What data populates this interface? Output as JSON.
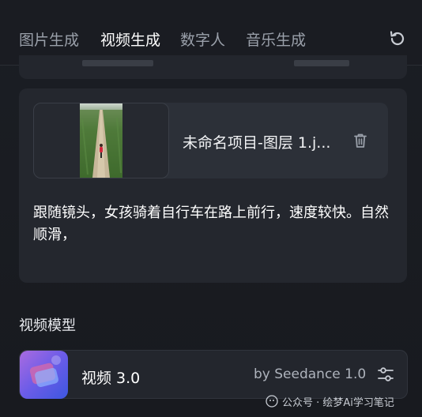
{
  "tabs": [
    {
      "label": "图片生成"
    },
    {
      "label": "视频生成",
      "active": true
    },
    {
      "label": "数字人"
    },
    {
      "label": "音乐生成"
    }
  ],
  "header": {
    "refresh_icon": "refresh-icon"
  },
  "upload": {
    "file_name": "未命名项目-图层 1.j...",
    "delete_icon": "trash-icon"
  },
  "prompt": {
    "text": "跟随镜头，女孩骑着自行车在路上前行，速度较快。自然顺滑，"
  },
  "model_section": {
    "title": "视频模型",
    "model_name": "视频 3.0",
    "provider": "by Seedance 1.0",
    "settings_icon": "sliders-icon"
  },
  "watermark": {
    "text": "公众号 · 绘梦Ai学习笔记"
  },
  "colors": {
    "background": "#1b1e24",
    "card": "#24272e",
    "active_text": "#ffffff",
    "inactive_text": "#9aa0aa"
  }
}
